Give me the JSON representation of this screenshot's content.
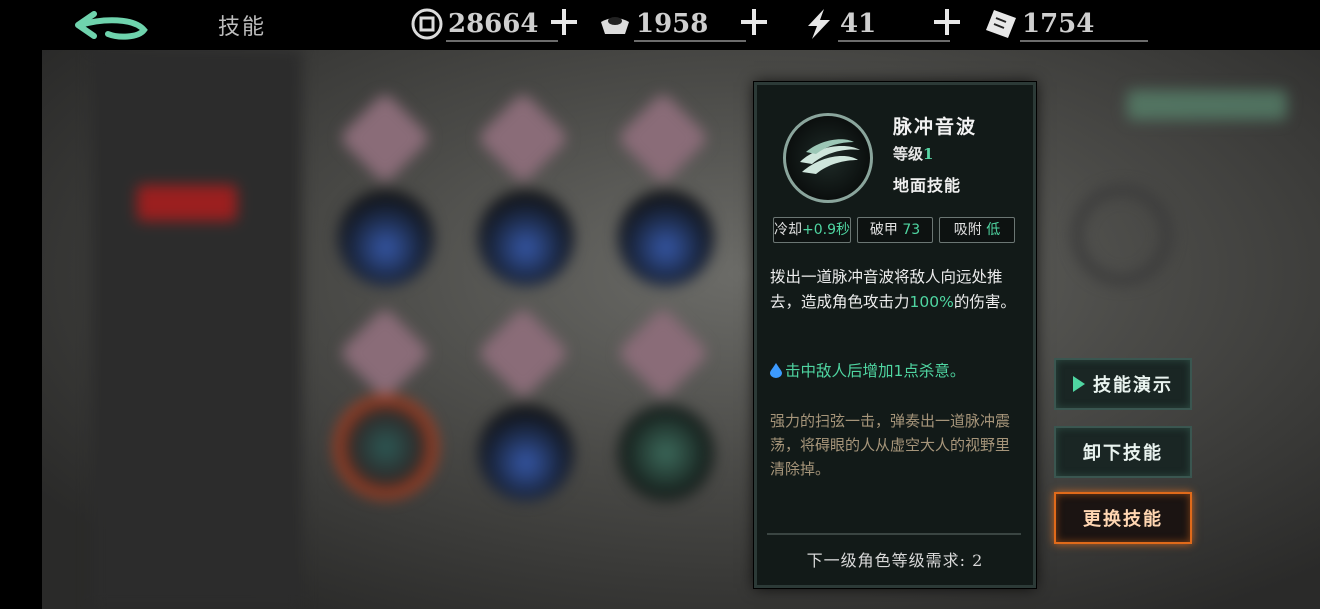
{
  "header": {
    "title": "技能",
    "resources": [
      {
        "name": "coin-icon",
        "value": "28664"
      },
      {
        "name": "ingot-icon",
        "value": "1958"
      },
      {
        "name": "energy-icon",
        "value": "41"
      },
      {
        "name": "ticket-icon",
        "value": "1754"
      }
    ]
  },
  "skill": {
    "name": "脉冲音波",
    "level_label": "等级",
    "level_value": "1",
    "type": "地面技能",
    "stats": [
      {
        "label": "冷却",
        "value": "+0.9秒"
      },
      {
        "label": "破甲",
        "value": "73"
      },
      {
        "label": "吸附",
        "value": "低"
      }
    ],
    "desc_part1": "拨出一道脉冲音波将敌人向远处推去，造成角色攻击力",
    "desc_highlight": "100%",
    "desc_part2": "的伤害。",
    "effect": "击中敌人后增加1点杀意。",
    "lore": "强力的扫弦一击，弹奏出一道脉冲震荡，将碍眼的人从虚空大人的视野里清除掉。",
    "requirement": "下一级角色等级需求: 2"
  },
  "buttons": {
    "demo": "技能演示",
    "unequip": "卸下技能",
    "replace": "更换技能"
  },
  "colors": {
    "accent_green": "#4fd5a1",
    "replace_border": "#e06a1a"
  }
}
